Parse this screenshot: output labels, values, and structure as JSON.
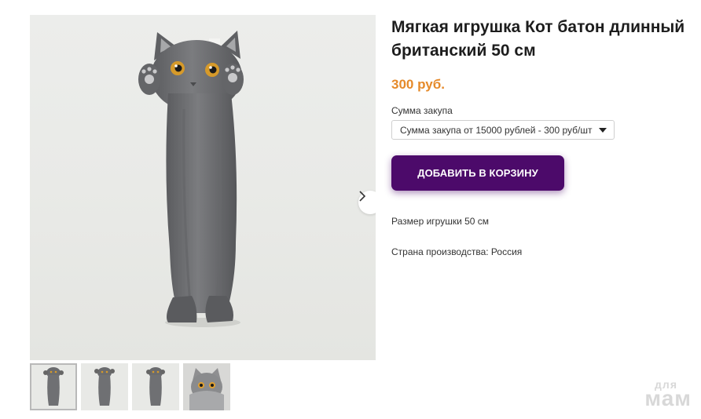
{
  "product": {
    "title": "Мягкая игрушка Кот батон длинный британский 50 см",
    "price": "300 руб.",
    "purchase_label": "Сумма закупа",
    "purchase_selected": "Сумма закупа от 15000 рублей - 300 руб/шт",
    "add_to_cart": "ДОБАВИТЬ В КОРЗИНУ",
    "size_info": "Размер игрушки 50 см",
    "country_info": "Страна производства: Россия"
  },
  "gallery": {
    "main_image": "grey-long-cat-plush",
    "next_icon": "chevron-right-icon",
    "thumbnails": [
      "cat-plush-front",
      "cat-plush-front-2",
      "cat-plush-front-3",
      "cat-plush-face-closeup"
    ]
  },
  "watermark": {
    "top": "для",
    "bottom": "мам"
  },
  "colors": {
    "price": "#e58a2a",
    "button": "#4c0a6a",
    "plush": "#6e6f71"
  }
}
